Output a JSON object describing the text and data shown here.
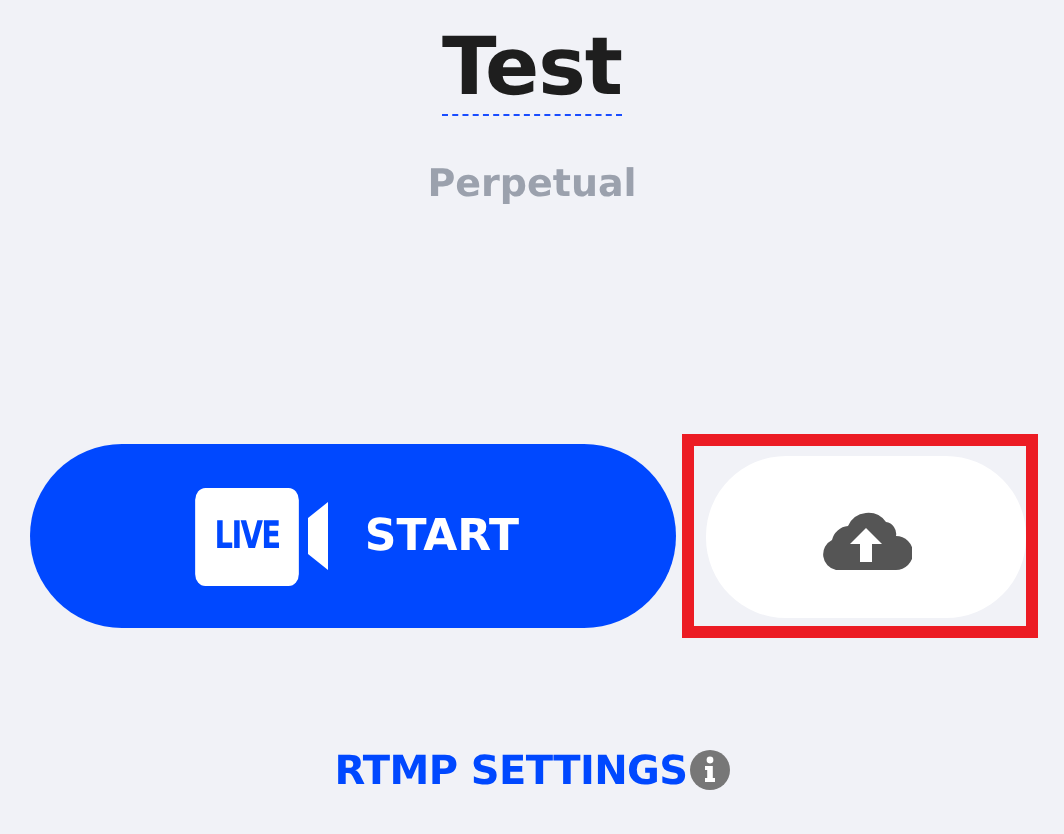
{
  "title": "Test",
  "subtitle": "Perpetual",
  "start_button": {
    "badge": "LIVE",
    "label": "START"
  },
  "upload_button": {
    "highlighted": true
  },
  "settings_link": {
    "label": "RTMP SETTINGS"
  }
}
